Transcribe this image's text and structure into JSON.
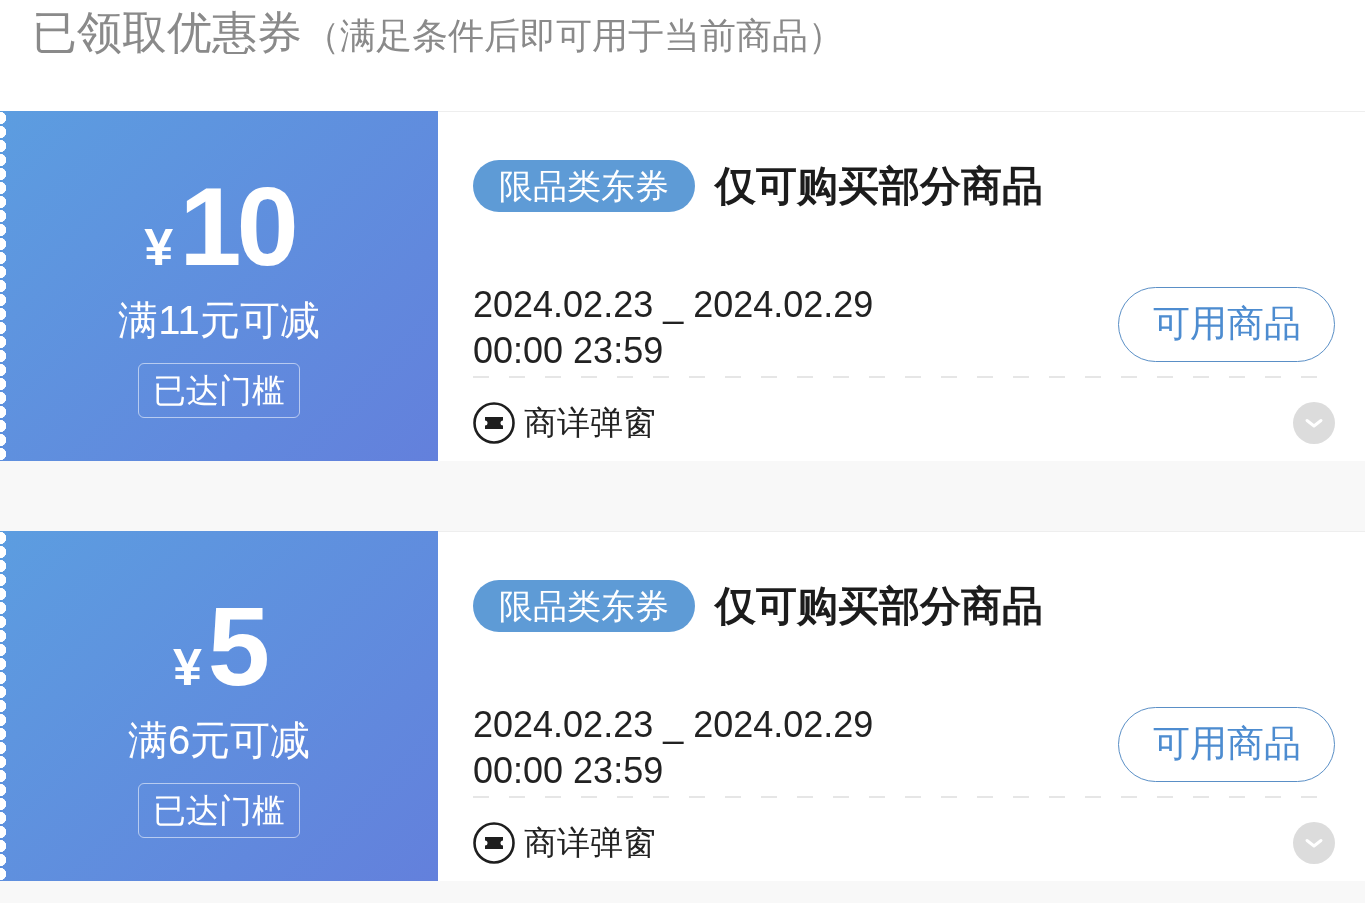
{
  "header": {
    "title": "已领取优惠券",
    "subtitle": "（满足条件后即可用于当前商品）"
  },
  "coupons": [
    {
      "currency": "¥",
      "amount": "10",
      "condition": "满11元可减",
      "threshold_badge": "已达门槛",
      "tag": "限品类东券",
      "title": "仅可购买部分商品",
      "valid_dates": "2024.02.23 _ 2024.02.29",
      "valid_times": "00:00 23:59",
      "action_button": "可用商品",
      "detail_link": "商详弹窗"
    },
    {
      "currency": "¥",
      "amount": "5",
      "condition": "满6元可减",
      "threshold_badge": "已达门槛",
      "tag": "限品类东券",
      "title": "仅可购买部分商品",
      "valid_dates": "2024.02.23 _ 2024.02.29",
      "valid_times": "00:00 23:59",
      "action_button": "可用商品",
      "detail_link": "商详弹窗"
    }
  ]
}
